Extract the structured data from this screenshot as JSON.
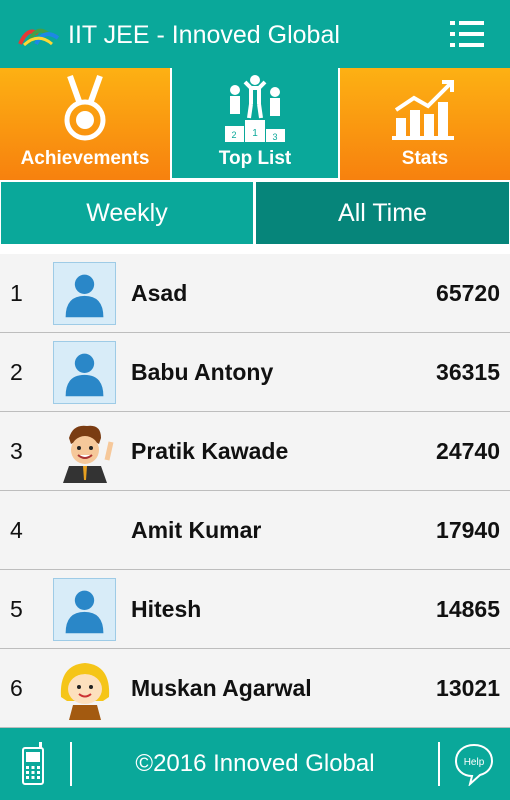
{
  "header": {
    "title": "IIT JEE - Innoved Global",
    "logo_icon": "colored-arc-logo",
    "menu_icon": "list-menu-icon"
  },
  "tabs": [
    {
      "label": "Achievements",
      "icon": "medal-icon",
      "active": false
    },
    {
      "label": "Top List",
      "icon": "podium-icon",
      "active": true
    },
    {
      "label": "Stats",
      "icon": "bar-chart-icon",
      "active": false
    }
  ],
  "period": {
    "weekly": "Weekly",
    "all_time": "All Time",
    "selected": "All Time"
  },
  "leaderboard": [
    {
      "rank": "1",
      "name": "Asad",
      "score": "65720",
      "avatar": "default-user-icon"
    },
    {
      "rank": "2",
      "name": "Babu Antony",
      "score": "36315",
      "avatar": "default-user-icon"
    },
    {
      "rank": "3",
      "name": "Pratik Kawade",
      "score": "24740",
      "avatar": "cartoon-boy-avatar"
    },
    {
      "rank": "4",
      "name": "Amit Kumar",
      "score": "17940",
      "avatar": "none"
    },
    {
      "rank": "5",
      "name": "Hitesh",
      "score": "14865",
      "avatar": "default-user-icon"
    },
    {
      "rank": "6",
      "name": "Muskan Agarwal",
      "score": "13021",
      "avatar": "cartoon-girl-avatar"
    }
  ],
  "footer": {
    "copyright": "©2016 Innoved Global",
    "help_label": "Help"
  },
  "colors": {
    "teal": "#0aa89a",
    "teal_dark": "#06857a",
    "orange_top": "#fdb113",
    "orange_bottom": "#f7810e"
  }
}
